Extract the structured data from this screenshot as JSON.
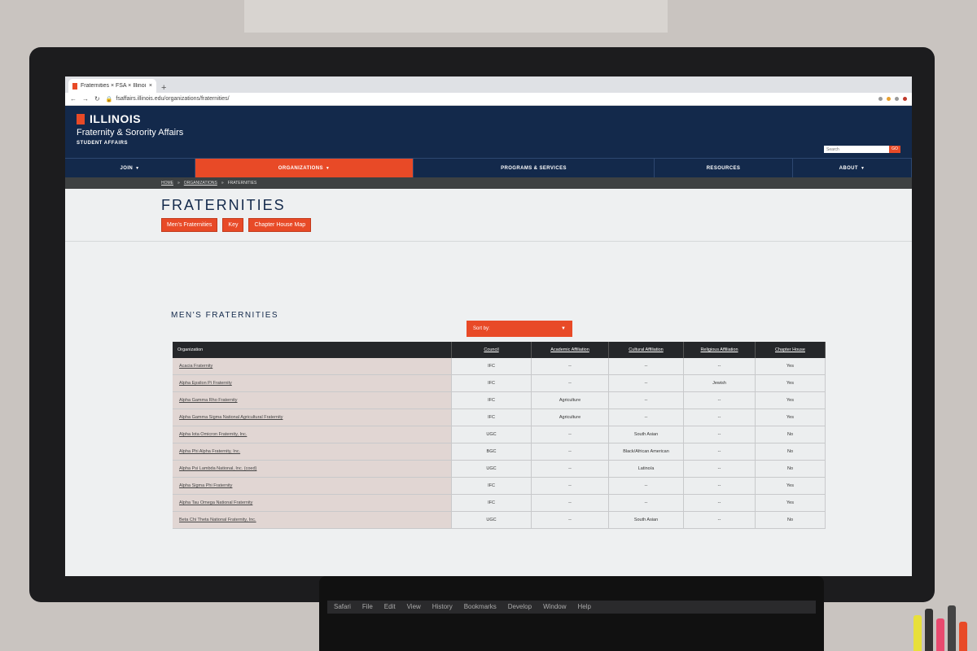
{
  "browser": {
    "tab_title": "Fraternities × FSA × Illinois",
    "tab_close": "×",
    "new_tab": "+",
    "back": "←",
    "forward": "→",
    "reload": "↻",
    "url": "fsaffairs.illinois.edu/organizations/fraternities/"
  },
  "header": {
    "brand": "ILLINOIS",
    "unit": "Fraternity & Sorority Affairs",
    "subunit": "STUDENT AFFAIRS",
    "search_placeholder": "Search",
    "search_button": "GO"
  },
  "nav": {
    "items": [
      "JOIN",
      "ORGANIZATIONS",
      "PROGRAMS & SERVICES",
      "RESOURCES",
      "ABOUT"
    ]
  },
  "breadcrumb": [
    "HOME",
    "ORGANIZATIONS",
    "FRATERNITIES"
  ],
  "page": {
    "title": "FRATERNITIES",
    "buttons": [
      "Men's Fraternities",
      "Key",
      "Chapter House Map"
    ],
    "section_title": "MEN'S FRATERNITIES",
    "sort_label": "Sort by:"
  },
  "table": {
    "headers": [
      "Organization",
      "Council",
      "Academic Affiliation",
      "Cultural Affiliation",
      "Religious Affiliation",
      "Chapter House"
    ],
    "rows": [
      [
        "Acacia Fraternity",
        "IFC",
        "--",
        "--",
        "--",
        "Yes"
      ],
      [
        "Alpha Epsilon Pi Fraternity",
        "IFC",
        "--",
        "--",
        "Jewish",
        "Yes"
      ],
      [
        "Alpha Gamma Rho Fraternity",
        "IFC",
        "Agriculture",
        "--",
        "--",
        "Yes"
      ],
      [
        "Alpha Gamma Sigma National Agricultural Fraternity",
        "IFC",
        "Agriculture",
        "--",
        "--",
        "Yes"
      ],
      [
        "Alpha Iota Omicron Fraternity, Inc.",
        "UGC",
        "--",
        "South Asian",
        "--",
        "No"
      ],
      [
        "Alpha Phi Alpha Fraternity, Inc.",
        "BGC",
        "--",
        "Black/African American",
        "--",
        "No"
      ],
      [
        "Alpha Psi Lambda National, Inc. (coed)",
        "UGC",
        "--",
        "Latino/a",
        "--",
        "No"
      ],
      [
        "Alpha Sigma Phi Fraternity",
        "IFC",
        "--",
        "--",
        "--",
        "Yes"
      ],
      [
        "Alpha Tau Omega National Fraternity",
        "IFC",
        "--",
        "--",
        "--",
        "Yes"
      ],
      [
        "Beta Chi Theta National Fraternity, Inc.",
        "UGC",
        "--",
        "South Asian",
        "--",
        "No"
      ]
    ]
  },
  "laptop_menu": [
    "Safari",
    "File",
    "Edit",
    "View",
    "History",
    "Bookmarks",
    "Develop",
    "Window",
    "Help"
  ]
}
